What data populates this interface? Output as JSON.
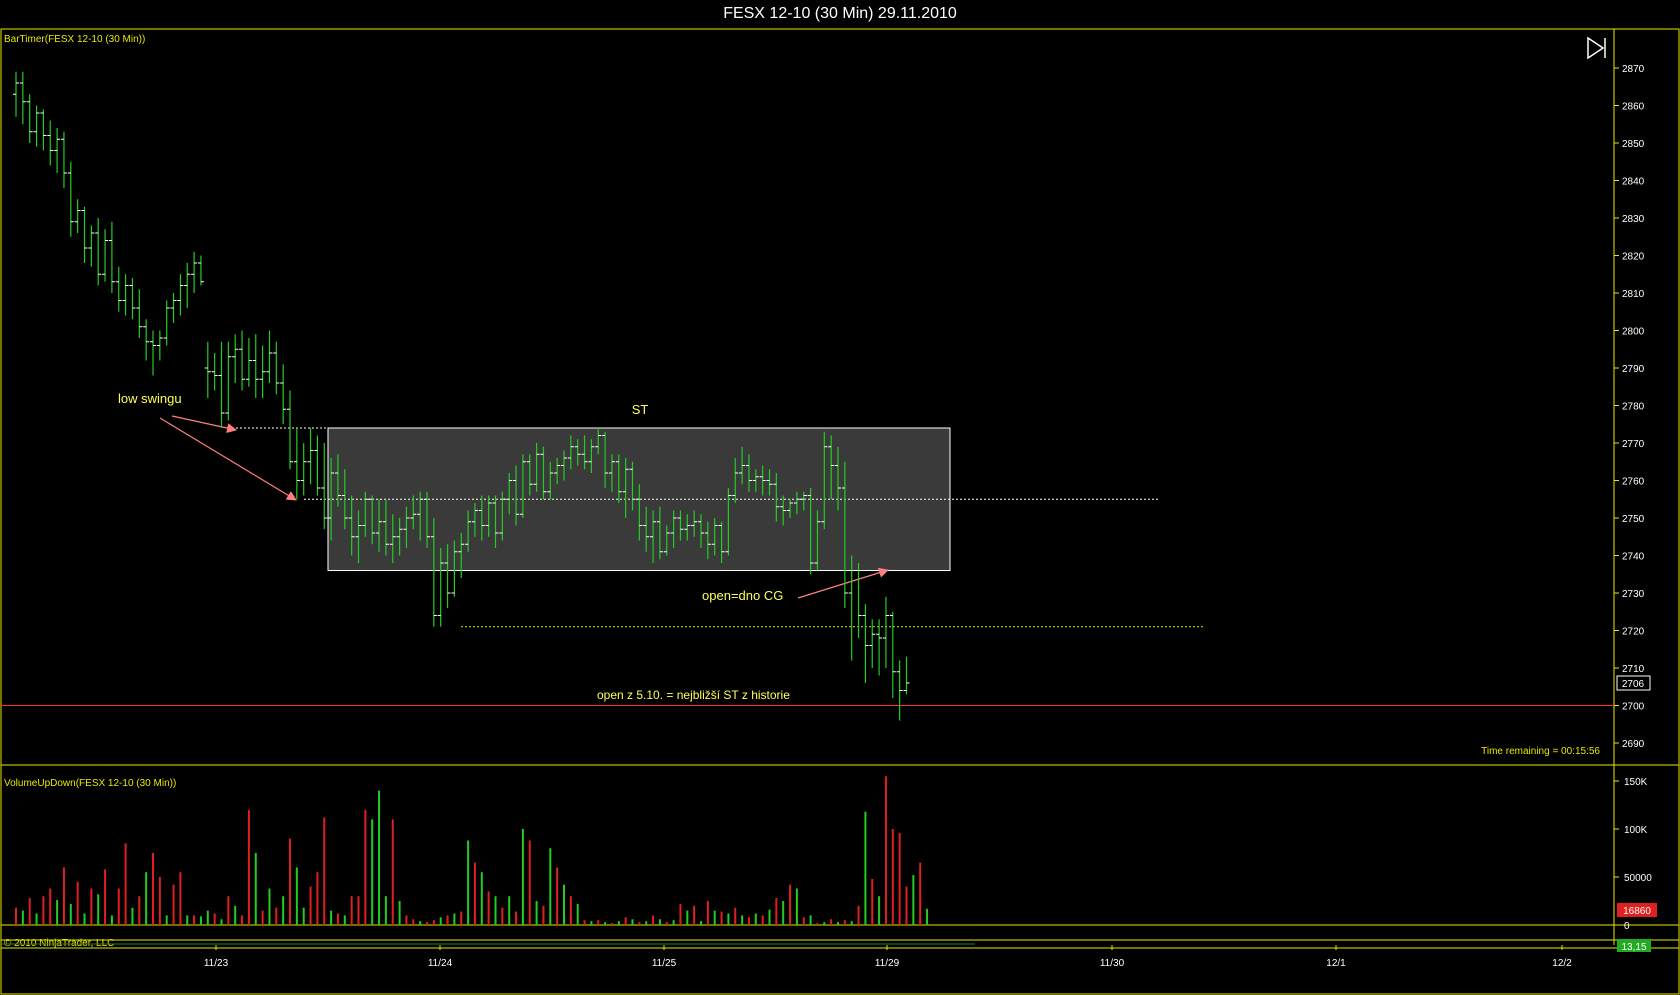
{
  "window": {
    "title": "FESX 12-10 (30 Min)  29.11.2010"
  },
  "price_panel": {
    "indicator_label": "BarTimer(FESX 12-10 (30 Min))",
    "time_remaining": "Time remaining = 00:15:56",
    "last_price_tag": "2706",
    "annotations": {
      "low_swing": "low swingu",
      "st": "ST",
      "open_cg": "open=dno CG",
      "open_history": "open z 5.10. = nejbližší ST z historie"
    },
    "y_ticks": [
      "2870",
      "2860",
      "2850",
      "2840",
      "2830",
      "2820",
      "2810",
      "2800",
      "2790",
      "2780",
      "2770",
      "2760",
      "2750",
      "2740",
      "2730",
      "2720",
      "2710",
      "2700",
      "2690"
    ]
  },
  "volume_panel": {
    "indicator_label": "VolumeUpDown(FESX 12-10 (30 Min))",
    "y_ticks": [
      "150K",
      "100K",
      "50000",
      "0"
    ],
    "last_volume_tag": "16860"
  },
  "footer": {
    "copyright": "© 2010 NinjaTrader, LLC",
    "value_tag": "13,15"
  },
  "x_axis": {
    "labels": [
      "11/23",
      "11/24",
      "11/25",
      "11/29",
      "11/30",
      "12/1",
      "12/2"
    ]
  },
  "colors": {
    "up_bar": "#22cc22",
    "down_bar": "#e02020",
    "axis": "#e8e800",
    "box_fill": "#3a3a3a",
    "ref_line": "#ff3030",
    "arrow": "#ff8080",
    "annotation_text": "#ffff55"
  },
  "chart_data": {
    "type": "ohlc",
    "price_ylim": [
      2685,
      2880
    ],
    "volume_ylim": [
      0,
      160000
    ],
    "reference_levels": {
      "swing_low": 2774,
      "box_mid": 2755,
      "st_box_top": 2774,
      "st_box_bottom": 2736,
      "cg_low": 2721,
      "history_open": 2700
    },
    "ohlc": [
      {
        "o": 2863,
        "h": 2869,
        "l": 2857,
        "c": 2866
      },
      {
        "o": 2866,
        "h": 2869,
        "l": 2855,
        "c": 2861
      },
      {
        "o": 2861,
        "h": 2863,
        "l": 2850,
        "c": 2853
      },
      {
        "o": 2853,
        "h": 2860,
        "l": 2849,
        "c": 2858
      },
      {
        "o": 2858,
        "h": 2859,
        "l": 2848,
        "c": 2852
      },
      {
        "o": 2852,
        "h": 2856,
        "l": 2844,
        "c": 2848
      },
      {
        "o": 2848,
        "h": 2854,
        "l": 2842,
        "c": 2851
      },
      {
        "o": 2851,
        "h": 2853,
        "l": 2838,
        "c": 2842
      },
      {
        "o": 2842,
        "h": 2845,
        "l": 2825,
        "c": 2829
      },
      {
        "o": 2829,
        "h": 2835,
        "l": 2826,
        "c": 2832
      },
      {
        "o": 2832,
        "h": 2833,
        "l": 2818,
        "c": 2822
      },
      {
        "o": 2822,
        "h": 2828,
        "l": 2817,
        "c": 2826
      },
      {
        "o": 2826,
        "h": 2830,
        "l": 2812,
        "c": 2815
      },
      {
        "o": 2815,
        "h": 2827,
        "l": 2813,
        "c": 2824
      },
      {
        "o": 2824,
        "h": 2829,
        "l": 2810,
        "c": 2813
      },
      {
        "o": 2813,
        "h": 2817,
        "l": 2805,
        "c": 2808
      },
      {
        "o": 2808,
        "h": 2815,
        "l": 2804,
        "c": 2812
      },
      {
        "o": 2812,
        "h": 2814,
        "l": 2803,
        "c": 2806
      },
      {
        "o": 2806,
        "h": 2811,
        "l": 2798,
        "c": 2801
      },
      {
        "o": 2801,
        "h": 2803,
        "l": 2792,
        "c": 2797
      },
      {
        "o": 2797,
        "h": 2800,
        "l": 2788,
        "c": 2796
      },
      {
        "o": 2796,
        "h": 2800,
        "l": 2792,
        "c": 2798
      },
      {
        "o": 2798,
        "h": 2808,
        "l": 2796,
        "c": 2806
      },
      {
        "o": 2806,
        "h": 2810,
        "l": 2802,
        "c": 2808
      },
      {
        "o": 2808,
        "h": 2815,
        "l": 2804,
        "c": 2812
      },
      {
        "o": 2812,
        "h": 2818,
        "l": 2806,
        "c": 2815
      },
      {
        "o": 2815,
        "h": 2821,
        "l": 2810,
        "c": 2818
      },
      {
        "o": 2818,
        "h": 2820,
        "l": 2812,
        "c": 2813
      },
      {
        "o": 2790,
        "h": 2797,
        "l": 2782,
        "c": 2789
      },
      {
        "o": 2789,
        "h": 2794,
        "l": 2784,
        "c": 2788
      },
      {
        "o": 2788,
        "h": 2797,
        "l": 2774,
        "c": 2778
      },
      {
        "o": 2778,
        "h": 2797,
        "l": 2776,
        "c": 2793
      },
      {
        "o": 2793,
        "h": 2799,
        "l": 2786,
        "c": 2795
      },
      {
        "o": 2795,
        "h": 2800,
        "l": 2784,
        "c": 2787
      },
      {
        "o": 2787,
        "h": 2798,
        "l": 2785,
        "c": 2792
      },
      {
        "o": 2792,
        "h": 2799,
        "l": 2782,
        "c": 2787
      },
      {
        "o": 2787,
        "h": 2796,
        "l": 2782,
        "c": 2789
      },
      {
        "o": 2789,
        "h": 2800,
        "l": 2786,
        "c": 2794
      },
      {
        "o": 2794,
        "h": 2797,
        "l": 2783,
        "c": 2786
      },
      {
        "o": 2786,
        "h": 2791,
        "l": 2775,
        "c": 2779
      },
      {
        "o": 2779,
        "h": 2784,
        "l": 2763,
        "c": 2765
      },
      {
        "o": 2765,
        "h": 2774,
        "l": 2755,
        "c": 2760
      },
      {
        "o": 2760,
        "h": 2770,
        "l": 2756,
        "c": 2765
      },
      {
        "o": 2765,
        "h": 2774,
        "l": 2759,
        "c": 2768
      },
      {
        "o": 2768,
        "h": 2772,
        "l": 2756,
        "c": 2758
      },
      {
        "o": 2758,
        "h": 2770,
        "l": 2747,
        "c": 2750
      },
      {
        "o": 2750,
        "h": 2766,
        "l": 2744,
        "c": 2762
      },
      {
        "o": 2762,
        "h": 2767,
        "l": 2753,
        "c": 2756
      },
      {
        "o": 2756,
        "h": 2763,
        "l": 2747,
        "c": 2750
      },
      {
        "o": 2750,
        "h": 2756,
        "l": 2740,
        "c": 2745
      },
      {
        "o": 2745,
        "h": 2752,
        "l": 2738,
        "c": 2748
      },
      {
        "o": 2748,
        "h": 2757,
        "l": 2745,
        "c": 2755
      },
      {
        "o": 2755,
        "h": 2756,
        "l": 2743,
        "c": 2746
      },
      {
        "o": 2746,
        "h": 2755,
        "l": 2741,
        "c": 2749
      },
      {
        "o": 2749,
        "h": 2755,
        "l": 2740,
        "c": 2743
      },
      {
        "o": 2743,
        "h": 2751,
        "l": 2738,
        "c": 2745
      },
      {
        "o": 2745,
        "h": 2750,
        "l": 2740,
        "c": 2747
      },
      {
        "o": 2747,
        "h": 2753,
        "l": 2742,
        "c": 2750
      },
      {
        "o": 2750,
        "h": 2756,
        "l": 2747,
        "c": 2751
      },
      {
        "o": 2751,
        "h": 2757,
        "l": 2744,
        "c": 2755
      },
      {
        "o": 2755,
        "h": 2757,
        "l": 2742,
        "c": 2745
      },
      {
        "o": 2745,
        "h": 2750,
        "l": 2721,
        "c": 2724
      },
      {
        "o": 2724,
        "h": 2742,
        "l": 2721,
        "c": 2738
      },
      {
        "o": 2738,
        "h": 2743,
        "l": 2726,
        "c": 2730
      },
      {
        "o": 2730,
        "h": 2744,
        "l": 2729,
        "c": 2741
      },
      {
        "o": 2741,
        "h": 2746,
        "l": 2734,
        "c": 2743
      },
      {
        "o": 2743,
        "h": 2752,
        "l": 2741,
        "c": 2749
      },
      {
        "o": 2749,
        "h": 2754,
        "l": 2745,
        "c": 2752
      },
      {
        "o": 2752,
        "h": 2756,
        "l": 2744,
        "c": 2748
      },
      {
        "o": 2748,
        "h": 2756,
        "l": 2745,
        "c": 2754
      },
      {
        "o": 2754,
        "h": 2756,
        "l": 2742,
        "c": 2746
      },
      {
        "o": 2746,
        "h": 2757,
        "l": 2744,
        "c": 2755
      },
      {
        "o": 2755,
        "h": 2762,
        "l": 2751,
        "c": 2760
      },
      {
        "o": 2760,
        "h": 2764,
        "l": 2748,
        "c": 2751
      },
      {
        "o": 2751,
        "h": 2767,
        "l": 2750,
        "c": 2765
      },
      {
        "o": 2765,
        "h": 2767,
        "l": 2756,
        "c": 2759
      },
      {
        "o": 2759,
        "h": 2770,
        "l": 2757,
        "c": 2767
      },
      {
        "o": 2767,
        "h": 2769,
        "l": 2755,
        "c": 2757
      },
      {
        "o": 2757,
        "h": 2765,
        "l": 2755,
        "c": 2762
      },
      {
        "o": 2762,
        "h": 2766,
        "l": 2759,
        "c": 2764
      },
      {
        "o": 2764,
        "h": 2768,
        "l": 2760,
        "c": 2766
      },
      {
        "o": 2766,
        "h": 2772,
        "l": 2763,
        "c": 2769
      },
      {
        "o": 2769,
        "h": 2771,
        "l": 2764,
        "c": 2767
      },
      {
        "o": 2767,
        "h": 2772,
        "l": 2763,
        "c": 2765
      },
      {
        "o": 2765,
        "h": 2771,
        "l": 2762,
        "c": 2769
      },
      {
        "o": 2769,
        "h": 2774,
        "l": 2767,
        "c": 2772
      },
      {
        "o": 2772,
        "h": 2773,
        "l": 2758,
        "c": 2762
      },
      {
        "o": 2762,
        "h": 2767,
        "l": 2757,
        "c": 2765
      },
      {
        "o": 2765,
        "h": 2767,
        "l": 2754,
        "c": 2757
      },
      {
        "o": 2757,
        "h": 2766,
        "l": 2750,
        "c": 2763
      },
      {
        "o": 2763,
        "h": 2765,
        "l": 2752,
        "c": 2755
      },
      {
        "o": 2755,
        "h": 2759,
        "l": 2744,
        "c": 2748
      },
      {
        "o": 2748,
        "h": 2753,
        "l": 2741,
        "c": 2745
      },
      {
        "o": 2745,
        "h": 2752,
        "l": 2738,
        "c": 2749
      },
      {
        "o": 2749,
        "h": 2753,
        "l": 2739,
        "c": 2741
      },
      {
        "o": 2741,
        "h": 2748,
        "l": 2740,
        "c": 2746
      },
      {
        "o": 2746,
        "h": 2752,
        "l": 2742,
        "c": 2750
      },
      {
        "o": 2750,
        "h": 2752,
        "l": 2744,
        "c": 2747
      },
      {
        "o": 2747,
        "h": 2751,
        "l": 2744,
        "c": 2748
      },
      {
        "o": 2748,
        "h": 2752,
        "l": 2745,
        "c": 2749
      },
      {
        "o": 2749,
        "h": 2751,
        "l": 2742,
        "c": 2746
      },
      {
        "o": 2746,
        "h": 2749,
        "l": 2739,
        "c": 2743
      },
      {
        "o": 2743,
        "h": 2750,
        "l": 2740,
        "c": 2748
      },
      {
        "o": 2748,
        "h": 2749,
        "l": 2738,
        "c": 2741
      },
      {
        "o": 2741,
        "h": 2758,
        "l": 2740,
        "c": 2756
      },
      {
        "o": 2756,
        "h": 2766,
        "l": 2754,
        "c": 2762
      },
      {
        "o": 2762,
        "h": 2769,
        "l": 2759,
        "c": 2764
      },
      {
        "o": 2764,
        "h": 2767,
        "l": 2757,
        "c": 2760
      },
      {
        "o": 2760,
        "h": 2763,
        "l": 2757,
        "c": 2761
      },
      {
        "o": 2761,
        "h": 2764,
        "l": 2756,
        "c": 2760
      },
      {
        "o": 2760,
        "h": 2763,
        "l": 2756,
        "c": 2759
      },
      {
        "o": 2759,
        "h": 2762,
        "l": 2749,
        "c": 2753
      },
      {
        "o": 2753,
        "h": 2756,
        "l": 2748,
        "c": 2752
      },
      {
        "o": 2752,
        "h": 2755,
        "l": 2750,
        "c": 2754
      },
      {
        "o": 2754,
        "h": 2757,
        "l": 2751,
        "c": 2755
      },
      {
        "o": 2755,
        "h": 2757,
        "l": 2752,
        "c": 2756
      },
      {
        "o": 2756,
        "h": 2758,
        "l": 2735,
        "c": 2738
      },
      {
        "o": 2738,
        "h": 2752,
        "l": 2736,
        "c": 2749
      },
      {
        "o": 2749,
        "h": 2773,
        "l": 2747,
        "c": 2769
      },
      {
        "o": 2769,
        "h": 2772,
        "l": 2755,
        "c": 2764
      },
      {
        "o": 2764,
        "h": 2769,
        "l": 2752,
        "c": 2758
      },
      {
        "o": 2758,
        "h": 2765,
        "l": 2726,
        "c": 2730
      },
      {
        "o": 2730,
        "h": 2740,
        "l": 2712,
        "c": 2736
      },
      {
        "o": 2736,
        "h": 2738,
        "l": 2718,
        "c": 2724
      },
      {
        "o": 2724,
        "h": 2727,
        "l": 2706,
        "c": 2716
      },
      {
        "o": 2716,
        "h": 2723,
        "l": 2710,
        "c": 2719
      },
      {
        "o": 2719,
        "h": 2723,
        "l": 2708,
        "c": 2718
      },
      {
        "o": 2718,
        "h": 2729,
        "l": 2710,
        "c": 2724
      },
      {
        "o": 2724,
        "h": 2725,
        "l": 2702,
        "c": 2709
      },
      {
        "o": 2709,
        "h": 2712,
        "l": 2696,
        "c": 2704
      },
      {
        "o": 2704,
        "h": 2713,
        "l": 2703,
        "c": 2706
      }
    ],
    "volume": [
      18000,
      15000,
      28000,
      12000,
      30000,
      38000,
      26000,
      60000,
      22000,
      45000,
      12000,
      38000,
      32000,
      58000,
      10000,
      38000,
      85000,
      18000,
      30000,
      55000,
      75000,
      50000,
      10000,
      42000,
      55000,
      10000,
      10000,
      9000,
      15000,
      12000,
      6000,
      30000,
      20000,
      10000,
      120000,
      75000,
      15000,
      38000,
      18000,
      30000,
      90000,
      60000,
      18000,
      40000,
      55000,
      112000,
      15000,
      12000,
      10000,
      30000,
      30000,
      120000,
      110000,
      140000,
      30000,
      110000,
      25000,
      10000,
      6000,
      4000,
      3000,
      5000,
      8000,
      10000,
      12000,
      14000,
      88000,
      65000,
      55000,
      35000,
      30000,
      18000,
      30000,
      14000,
      100000,
      88000,
      25000,
      20000,
      80000,
      60000,
      42000,
      30000,
      22000,
      5000,
      4000,
      5000,
      3000,
      2000,
      4000,
      8000,
      6000,
      3000,
      4000,
      10000,
      6000,
      3000,
      5000,
      22000,
      15000,
      20000,
      4000,
      25000,
      15000,
      14000,
      12000,
      18000,
      10000,
      8000,
      12000,
      10000,
      16000,
      28000,
      25000,
      42000,
      38000,
      8000,
      10000,
      2000,
      3000,
      6000,
      3000,
      5000,
      4000,
      20000,
      118000,
      48000,
      30000,
      155000,
      100000,
      96000,
      40000,
      52000,
      65000,
      16860
    ],
    "volume_up": [
      false,
      true,
      false,
      true,
      false,
      false,
      true,
      false,
      true,
      false,
      true,
      false,
      true,
      false,
      true,
      false,
      false,
      true,
      false,
      true,
      false,
      false,
      true,
      false,
      false,
      true,
      false,
      true,
      true,
      false,
      true,
      false,
      true,
      false,
      false,
      true,
      false,
      true,
      false,
      true,
      false,
      true,
      true,
      false,
      false,
      false,
      true,
      false,
      true,
      false,
      false,
      false,
      true,
      true,
      true,
      false,
      true,
      false,
      false,
      true,
      false,
      false,
      true,
      false,
      true,
      false,
      true,
      false,
      true,
      false,
      true,
      false,
      true,
      false,
      true,
      false,
      true,
      false,
      true,
      false,
      true,
      false,
      true,
      false,
      true,
      false,
      true,
      false,
      true,
      false,
      true,
      false,
      true,
      false,
      true,
      false,
      true,
      false,
      true,
      false,
      true,
      false,
      true,
      false,
      true,
      false,
      true,
      false,
      true,
      false,
      true,
      false,
      true,
      false,
      true,
      false,
      true,
      false,
      true,
      false,
      true,
      false,
      true,
      false,
      true,
      false,
      true,
      false,
      false,
      false,
      false,
      true,
      false,
      true,
      false
    ]
  }
}
